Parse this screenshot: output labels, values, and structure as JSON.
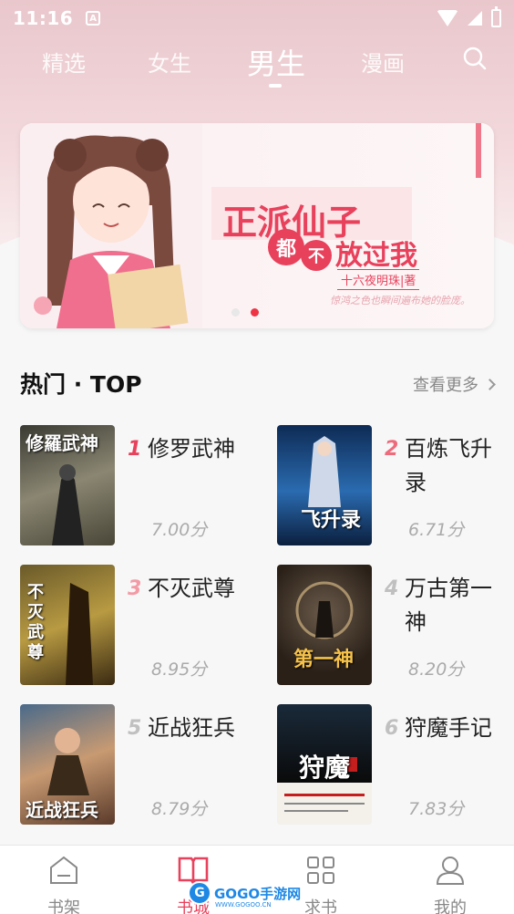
{
  "status_bar": {
    "time": "11:16",
    "notification_icon": "A"
  },
  "tabs": [
    {
      "label": "精选",
      "active": false
    },
    {
      "label": "女生",
      "active": false
    },
    {
      "label": "男生",
      "active": true
    },
    {
      "label": "漫画",
      "active": false
    }
  ],
  "banner": {
    "title": "正派仙子",
    "char1": "都",
    "char2": "不",
    "subtitle": "放过我",
    "author": "十六夜明珠|著",
    "tagline": "惊鸿之色也瞬间遍布她的脸庞。",
    "slides": 2,
    "active_slide": 2
  },
  "section": {
    "title": "热门 · TOP",
    "more_label": "查看更多"
  },
  "books": [
    {
      "rank": "1",
      "name": "修罗武神",
      "score": "7.00分",
      "cover_text": "修羅武神",
      "rank_color": "#e8415c"
    },
    {
      "rank": "2",
      "name": "百炼飞升录",
      "score": "6.71分",
      "cover_text": "飞升录",
      "rank_color": "#ee6b7b"
    },
    {
      "rank": "3",
      "name": "不灭武尊",
      "score": "8.95分",
      "cover_text": "不灭武尊",
      "rank_color": "#f39aa5"
    },
    {
      "rank": "4",
      "name": "万古第一神",
      "score": "8.20分",
      "cover_text": "第一神",
      "rank_color": "#c0c0c0"
    },
    {
      "rank": "5",
      "name": "近战狂兵",
      "score": "8.79分",
      "cover_text": "近战狂兵",
      "rank_color": "#c0c0c0"
    },
    {
      "rank": "6",
      "name": "狩魔手记",
      "score": "7.83分",
      "cover_text": "狩魔",
      "rank_color": "#c0c0c0"
    }
  ],
  "bottom_nav": [
    {
      "label": "书架",
      "icon": "bookshelf-icon",
      "active": false
    },
    {
      "label": "书城",
      "icon": "open-book-icon",
      "active": true
    },
    {
      "label": "求书",
      "icon": "grid-icon",
      "active": false
    },
    {
      "label": "我的",
      "icon": "user-icon",
      "active": false
    }
  ],
  "watermark": {
    "badge": "G",
    "text": "GOGO手游网",
    "sub": "WWW.GOGOO.CN"
  },
  "colors": {
    "accent": "#e8415c",
    "inactive_nav": "#888888"
  }
}
